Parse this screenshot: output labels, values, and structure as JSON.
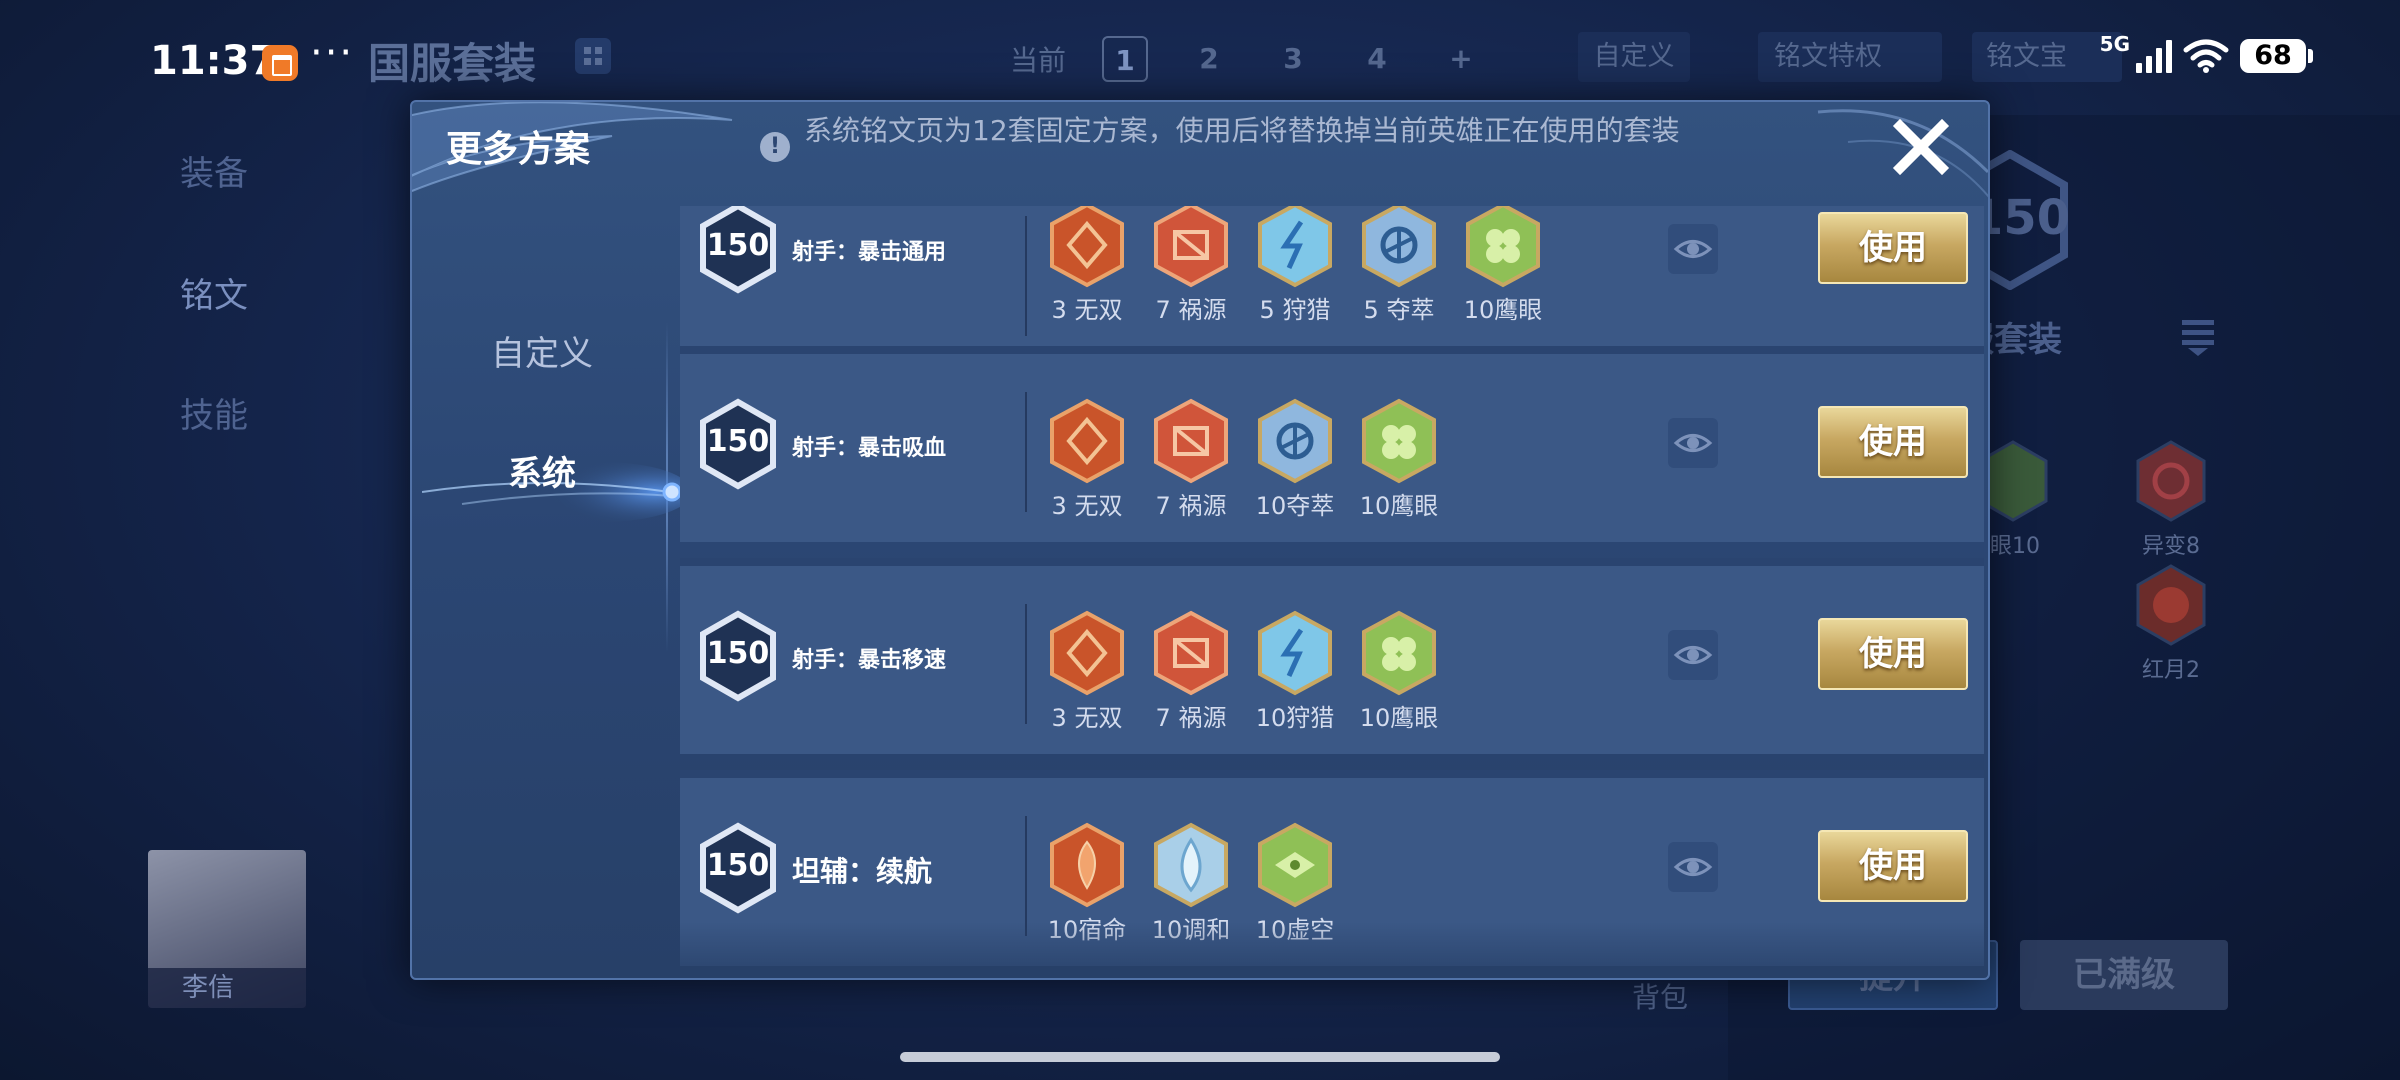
{
  "status_bar": {
    "time": "11:37",
    "dots": "···",
    "network": "5G",
    "battery": "68"
  },
  "background": {
    "title": "国服套装",
    "current_label": "当前",
    "pages": [
      "1",
      "2",
      "3",
      "4",
      "+"
    ],
    "active_page": "1",
    "custom_button": "自定义",
    "privilege_button": "铭文特权",
    "box_button": "铭文宝",
    "left_nav": [
      "装备",
      "铭文",
      "技能"
    ],
    "hero_name": "李信",
    "set_level": "150",
    "set_name": "服套装",
    "rune_labels": [
      "眼10",
      "异变8",
      "红月2"
    ],
    "bag_label": "背包",
    "button_left": "提升",
    "button_right": "已满级"
  },
  "modal": {
    "title": "更多方案",
    "notice": "系统铭文页为12套固定方案，使用后将替换掉当前英雄正在使用的套装",
    "close_icon": "close-icon",
    "tabs": [
      {
        "label": "自定义",
        "active": false
      },
      {
        "label": "系统",
        "active": true
      }
    ],
    "schemes": [
      {
        "level": "150",
        "name": "射手：暴击通用",
        "runes": [
          {
            "label": "3 无双",
            "icon": "wushuang",
            "color": "#c9542a"
          },
          {
            "label": "7 祸源",
            "icon": "huoyuan",
            "color": "#d0553a"
          },
          {
            "label": "5 狩猎",
            "icon": "shoulie",
            "color": "#7fc7e8"
          },
          {
            "label": "5 夺萃",
            "icon": "duocui",
            "color": "#8fb7de"
          },
          {
            "label": "10鹰眼",
            "icon": "yingyan",
            "color": "#8fc056"
          }
        ],
        "use_label": "使用"
      },
      {
        "level": "150",
        "name": "射手：暴击吸血",
        "runes": [
          {
            "label": "3 无双",
            "icon": "wushuang",
            "color": "#c9542a"
          },
          {
            "label": "7 祸源",
            "icon": "huoyuan",
            "color": "#d0553a"
          },
          {
            "label": "10夺萃",
            "icon": "duocui",
            "color": "#8fb7de"
          },
          {
            "label": "10鹰眼",
            "icon": "yingyan",
            "color": "#8fc056"
          }
        ],
        "use_label": "使用"
      },
      {
        "level": "150",
        "name": "射手：暴击移速",
        "runes": [
          {
            "label": "3 无双",
            "icon": "wushuang",
            "color": "#c9542a"
          },
          {
            "label": "7 祸源",
            "icon": "huoyuan",
            "color": "#d0553a"
          },
          {
            "label": "10狩猎",
            "icon": "shoulie",
            "color": "#7fc7e8"
          },
          {
            "label": "10鹰眼",
            "icon": "yingyan",
            "color": "#8fc056"
          }
        ],
        "use_label": "使用"
      },
      {
        "level": "150",
        "name": "坦辅：续航",
        "runes": [
          {
            "label": "10宿命",
            "icon": "suming",
            "color": "#c9542a"
          },
          {
            "label": "10调和",
            "icon": "tiaohe",
            "color": "#a9cfe8"
          },
          {
            "label": "10虚空",
            "icon": "xukong",
            "color": "#8fc056"
          }
        ],
        "use_label": "使用"
      }
    ]
  },
  "colors": {
    "accent_gold": "#c8a862",
    "modal_bg": "#2b4673",
    "row_bg": "#3b5886"
  }
}
